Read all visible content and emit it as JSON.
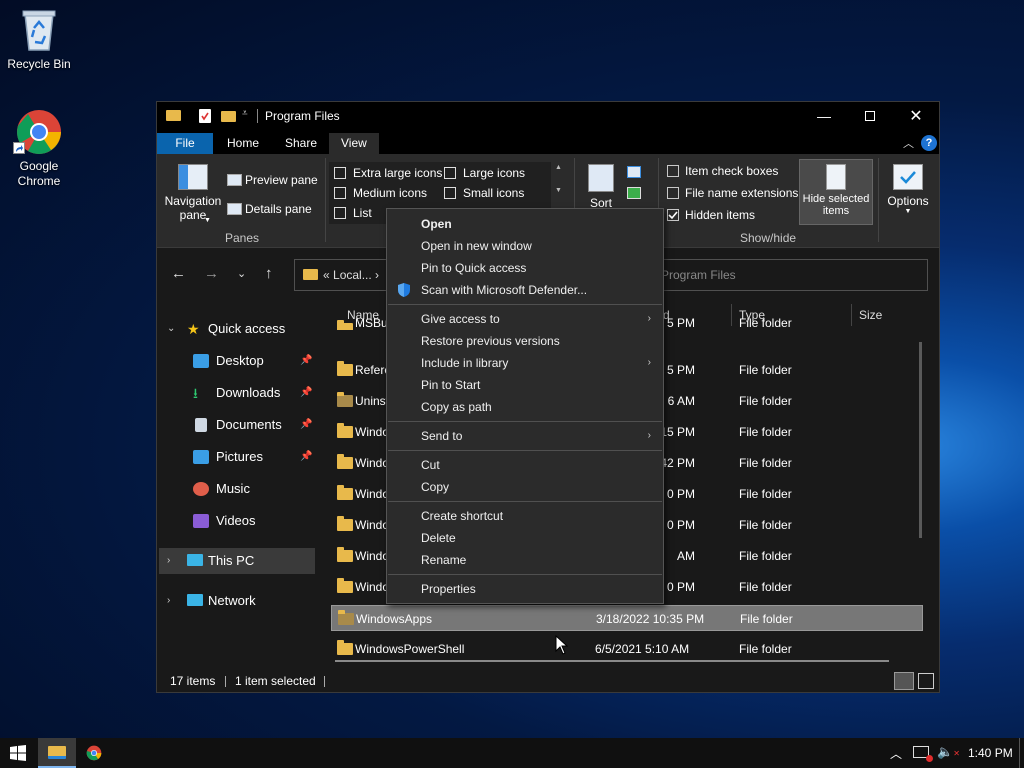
{
  "desktop": {
    "icons": [
      {
        "label": "Recycle Bin"
      },
      {
        "label": "Google\nChrome",
        "line1": "Google",
        "line2": "Chrome"
      }
    ]
  },
  "window": {
    "title": "Program Files",
    "tabs": [
      "File",
      "Home",
      "Share",
      "View"
    ],
    "active_tab": "View",
    "ribbon": {
      "navigation_pane": "Navigation",
      "navigation_pane2": "pane",
      "preview_pane": "Preview pane",
      "details_pane": "Details pane",
      "panes_group": "Panes",
      "layout": {
        "extra_large_icons": "Extra large icons",
        "large_icons": "Large icons",
        "medium_icons": "Medium icons",
        "small_icons": "Small icons",
        "list": "List"
      },
      "sort": "Sort",
      "item_check_boxes": "Item check boxes",
      "file_name_extensions": "File name extensions",
      "hidden_items": "Hidden items",
      "hide_selected_items": "Hide selected",
      "hide_selected_items2": "items",
      "show_hide_group": "Show/hide",
      "options": "Options"
    },
    "address": {
      "crumb": "Local...",
      "search_placeholder": "Program Files"
    },
    "sidebar": {
      "quick_access": "Quick access",
      "items": [
        {
          "label": "Desktop",
          "pinned": true
        },
        {
          "label": "Downloads",
          "pinned": true
        },
        {
          "label": "Documents",
          "pinned": true
        },
        {
          "label": "Pictures",
          "pinned": true
        },
        {
          "label": "Music"
        },
        {
          "label": "Videos"
        }
      ],
      "this_pc": "This PC",
      "network": "Network"
    },
    "columns": {
      "name": "Name",
      "date": "d",
      "type": "Type",
      "size": "Size"
    },
    "rows": [
      {
        "name": "MSBu",
        "date": "5 PM",
        "type": "File folder"
      },
      {
        "name": "Refere",
        "date": "5 PM",
        "type": "File folder"
      },
      {
        "name": "Uninst",
        "date": "6 AM",
        "type": "File folder"
      },
      {
        "name": "Windo",
        "date": "15 PM",
        "type": "File folder"
      },
      {
        "name": "Windo",
        "date": "42 PM",
        "type": "File folder"
      },
      {
        "name": "Windo",
        "date": "0 PM",
        "type": "File folder"
      },
      {
        "name": "Windo",
        "date": "0 PM",
        "type": "File folder"
      },
      {
        "name": "Windo",
        "date": "AM",
        "type": "File folder"
      },
      {
        "name": "Windo",
        "date": "0 PM",
        "type": "File folder"
      },
      {
        "name": "WindowsApps",
        "date": "3/18/2022 10:35 PM",
        "type": "File folder",
        "selected": true
      },
      {
        "name": "WindowsPowerShell",
        "date": "6/5/2021 5:10 AM",
        "type": "File folder"
      }
    ],
    "status": {
      "items": "17 items",
      "selected": "1 item selected"
    }
  },
  "context_menu": {
    "items": [
      "Open",
      "Open in new window",
      "Pin to Quick access",
      "Scan with Microsoft Defender...",
      "Give access to",
      "Restore previous versions",
      "Include in library",
      "Pin to Start",
      "Copy as path",
      "Send to",
      "Cut",
      "Copy",
      "Create shortcut",
      "Delete",
      "Rename",
      "Properties"
    ]
  },
  "taskbar": {
    "time": "1:40 PM"
  },
  "colors": {
    "accent": "#0a64ad",
    "folder": "#e8b94b",
    "selected_row": "#777777"
  }
}
